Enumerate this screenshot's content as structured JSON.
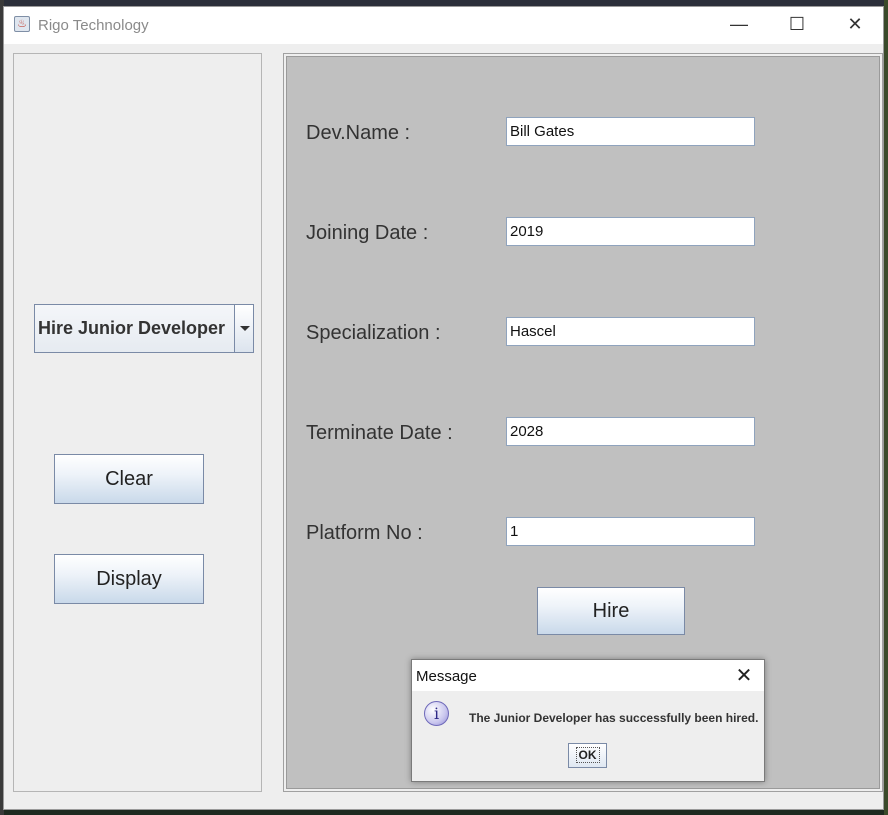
{
  "window": {
    "title": "Rigo Technology",
    "controls": {
      "minimize": "—",
      "maximize": "☐",
      "close": "✕"
    }
  },
  "left_panel": {
    "combo_value": "Hire Junior Developer",
    "clear_label": "Clear",
    "display_label": "Display"
  },
  "form": {
    "name_label": "Dev.Name :",
    "name_value": "Bill Gates",
    "joining_label": "Joining Date :",
    "joining_value": "2019",
    "specialization_label": "Specialization :",
    "specialization_value": "Hascel",
    "terminate_label": "Terminate Date :",
    "terminate_value": "2028",
    "platform_label": "Platform No :",
    "platform_value": "1",
    "hire_label": "Hire"
  },
  "dialog": {
    "title": "Message",
    "close": "✕",
    "message": "The Junior Developer has successfully been hired.",
    "ok_label": "OK",
    "icon_glyph": "i"
  }
}
